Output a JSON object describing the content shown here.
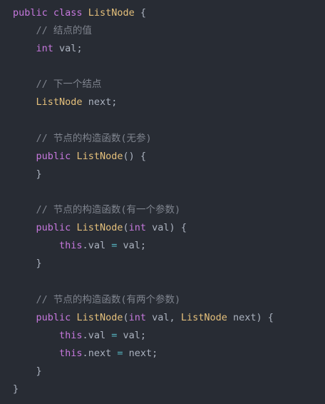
{
  "code": {
    "language": "java",
    "lines": [
      [
        {
          "t": "kw",
          "v": "public"
        },
        {
          "t": "ws",
          "v": " "
        },
        {
          "t": "kw",
          "v": "class"
        },
        {
          "t": "ws",
          "v": " "
        },
        {
          "t": "cls",
          "v": "ListNode"
        },
        {
          "t": "ws",
          "v": " "
        },
        {
          "t": "pn",
          "v": "{"
        }
      ],
      [
        {
          "t": "ws",
          "v": "    "
        },
        {
          "t": "cm",
          "v": "// 结点的值"
        }
      ],
      [
        {
          "t": "ws",
          "v": "    "
        },
        {
          "t": "kw",
          "v": "int"
        },
        {
          "t": "ws",
          "v": " "
        },
        {
          "t": "id",
          "v": "val"
        },
        {
          "t": "pn",
          "v": ";"
        }
      ],
      [],
      [
        {
          "t": "ws",
          "v": "    "
        },
        {
          "t": "cm",
          "v": "// 下一个结点"
        }
      ],
      [
        {
          "t": "ws",
          "v": "    "
        },
        {
          "t": "cls",
          "v": "ListNode"
        },
        {
          "t": "ws",
          "v": " "
        },
        {
          "t": "id",
          "v": "next"
        },
        {
          "t": "pn",
          "v": ";"
        }
      ],
      [],
      [
        {
          "t": "ws",
          "v": "    "
        },
        {
          "t": "cm",
          "v": "// 节点的构造函数(无参)"
        }
      ],
      [
        {
          "t": "ws",
          "v": "    "
        },
        {
          "t": "kw",
          "v": "public"
        },
        {
          "t": "ws",
          "v": " "
        },
        {
          "t": "cls",
          "v": "ListNode"
        },
        {
          "t": "pn",
          "v": "()"
        },
        {
          "t": "ws",
          "v": " "
        },
        {
          "t": "pn",
          "v": "{"
        }
      ],
      [
        {
          "t": "ws",
          "v": "    "
        },
        {
          "t": "pn",
          "v": "}"
        }
      ],
      [],
      [
        {
          "t": "ws",
          "v": "    "
        },
        {
          "t": "cm",
          "v": "// 节点的构造函数(有一个参数)"
        }
      ],
      [
        {
          "t": "ws",
          "v": "    "
        },
        {
          "t": "kw",
          "v": "public"
        },
        {
          "t": "ws",
          "v": " "
        },
        {
          "t": "cls",
          "v": "ListNode"
        },
        {
          "t": "pn",
          "v": "("
        },
        {
          "t": "kw",
          "v": "int"
        },
        {
          "t": "ws",
          "v": " "
        },
        {
          "t": "id",
          "v": "val"
        },
        {
          "t": "pn",
          "v": ")"
        },
        {
          "t": "ws",
          "v": " "
        },
        {
          "t": "pn",
          "v": "{"
        }
      ],
      [
        {
          "t": "ws",
          "v": "        "
        },
        {
          "t": "kw",
          "v": "this"
        },
        {
          "t": "pn",
          "v": "."
        },
        {
          "t": "id",
          "v": "val"
        },
        {
          "t": "ws",
          "v": " "
        },
        {
          "t": "op",
          "v": "="
        },
        {
          "t": "ws",
          "v": " "
        },
        {
          "t": "id",
          "v": "val"
        },
        {
          "t": "pn",
          "v": ";"
        }
      ],
      [
        {
          "t": "ws",
          "v": "    "
        },
        {
          "t": "pn",
          "v": "}"
        }
      ],
      [],
      [
        {
          "t": "ws",
          "v": "    "
        },
        {
          "t": "cm",
          "v": "// 节点的构造函数(有两个参数)"
        }
      ],
      [
        {
          "t": "ws",
          "v": "    "
        },
        {
          "t": "kw",
          "v": "public"
        },
        {
          "t": "ws",
          "v": " "
        },
        {
          "t": "cls",
          "v": "ListNode"
        },
        {
          "t": "pn",
          "v": "("
        },
        {
          "t": "kw",
          "v": "int"
        },
        {
          "t": "ws",
          "v": " "
        },
        {
          "t": "id",
          "v": "val"
        },
        {
          "t": "pn",
          "v": ","
        },
        {
          "t": "ws",
          "v": " "
        },
        {
          "t": "cls",
          "v": "ListNode"
        },
        {
          "t": "ws",
          "v": " "
        },
        {
          "t": "id",
          "v": "next"
        },
        {
          "t": "pn",
          "v": ")"
        },
        {
          "t": "ws",
          "v": " "
        },
        {
          "t": "pn",
          "v": "{"
        }
      ],
      [
        {
          "t": "ws",
          "v": "        "
        },
        {
          "t": "kw",
          "v": "this"
        },
        {
          "t": "pn",
          "v": "."
        },
        {
          "t": "id",
          "v": "val"
        },
        {
          "t": "ws",
          "v": " "
        },
        {
          "t": "op",
          "v": "="
        },
        {
          "t": "ws",
          "v": " "
        },
        {
          "t": "id",
          "v": "val"
        },
        {
          "t": "pn",
          "v": ";"
        }
      ],
      [
        {
          "t": "ws",
          "v": "        "
        },
        {
          "t": "kw",
          "v": "this"
        },
        {
          "t": "pn",
          "v": "."
        },
        {
          "t": "id",
          "v": "next"
        },
        {
          "t": "ws",
          "v": " "
        },
        {
          "t": "op",
          "v": "="
        },
        {
          "t": "ws",
          "v": " "
        },
        {
          "t": "id",
          "v": "next"
        },
        {
          "t": "pn",
          "v": ";"
        }
      ],
      [
        {
          "t": "ws",
          "v": "    "
        },
        {
          "t": "pn",
          "v": "}"
        }
      ],
      [
        {
          "t": "pn",
          "v": "}"
        }
      ]
    ]
  },
  "colors": {
    "background": "#282c34",
    "keyword": "#c678dd",
    "class_name": "#e5c07b",
    "comment": "#7f848e",
    "operator": "#56b6c2",
    "text": "#abb2bf"
  }
}
